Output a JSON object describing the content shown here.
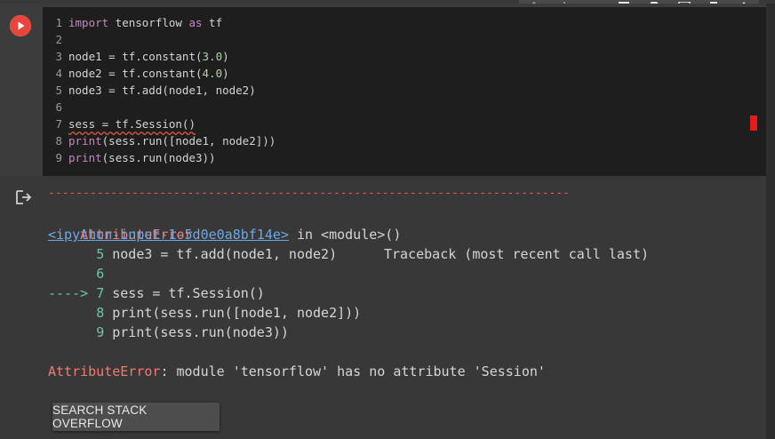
{
  "toolbar": {
    "icons": [
      "arrow-up-icon",
      "arrow-down-icon",
      "link-icon",
      "comment-icon",
      "gear-icon",
      "mirror-icon",
      "delete-icon",
      "more-icon"
    ]
  },
  "code": {
    "lines": [
      {
        "n": "1",
        "text": "import tensorflow as tf"
      },
      {
        "n": "2",
        "text": ""
      },
      {
        "n": "3",
        "text": "node1 = tf.constant(3.0)"
      },
      {
        "n": "4",
        "text": "node2 = tf.constant(4.0)"
      },
      {
        "n": "5",
        "text": "node3 = tf.add(node1, node2)"
      },
      {
        "n": "6",
        "text": ""
      },
      {
        "n": "7",
        "text": "sess = tf.Session()"
      },
      {
        "n": "8",
        "text": "print(sess.run([node1, node2]))"
      },
      {
        "n": "9",
        "text": "print(sess.run(node3))"
      }
    ]
  },
  "output": {
    "dashes": "---------------------------------------------------------------------------",
    "error_name": "AttributeError",
    "traceback_label": "Traceback (most recent call last)",
    "input_link": "<ipython-input-1-5d0e0a8bf14e>",
    "in_module": " in <module>()",
    "tb_lines": [
      {
        "prefix": "      ",
        "n": "5",
        "code": " node3 = tf.add(node1, node2)"
      },
      {
        "prefix": "      ",
        "n": "6",
        "code": ""
      },
      {
        "prefix": "----> ",
        "n": "7",
        "code": " sess = tf.Session()"
      },
      {
        "prefix": "      ",
        "n": "8",
        "code": " print(sess.run([node1, node2]))"
      },
      {
        "prefix": "      ",
        "n": "9",
        "code": " print(sess.run(node3))"
      }
    ],
    "final_error_name": "AttributeError",
    "final_error_msg": ": module 'tensorflow' has no attribute 'Session'",
    "so_button": "SEARCH STACK OVERFLOW"
  }
}
